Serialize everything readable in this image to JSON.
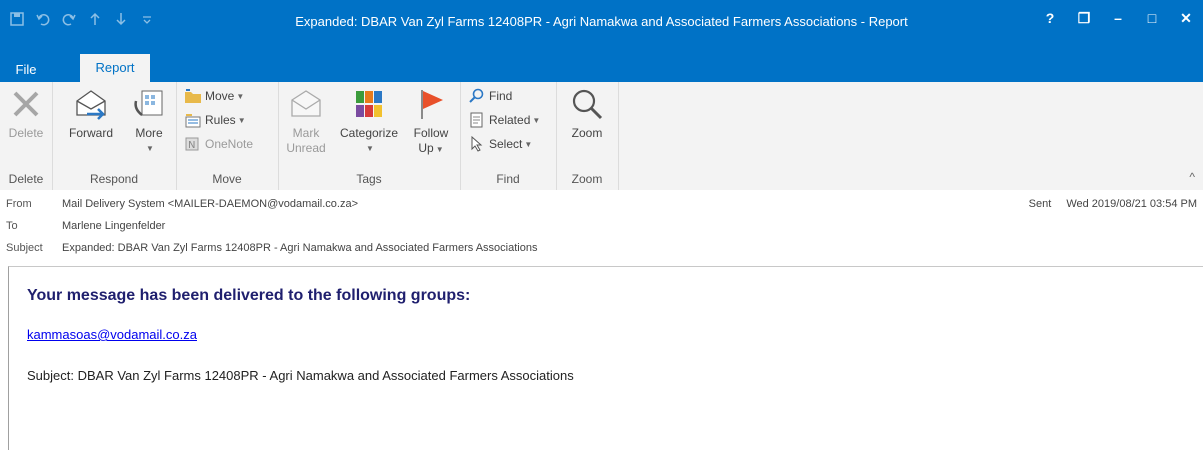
{
  "window": {
    "title": "Expanded: DBAR Van Zyl Farms 12408PR - Agri Namakwa and Associated Farmers Associations - Report",
    "controls": [
      "?",
      "❐",
      "–",
      "□",
      "✕"
    ]
  },
  "tabs": {
    "file": "File",
    "report": "Report"
  },
  "ribbon": {
    "delete": {
      "button": "Delete",
      "group": "Delete"
    },
    "respond": {
      "forward": "Forward",
      "more": "More",
      "group": "Respond"
    },
    "move": {
      "move": "Move",
      "rules": "Rules",
      "onenote": "OneNote",
      "group": "Move"
    },
    "tags": {
      "mark_unread_1": "Mark",
      "mark_unread_2": "Unread",
      "categorize": "Categorize",
      "follow_up_1": "Follow",
      "follow_up_2": "Up",
      "group": "Tags"
    },
    "find": {
      "find": "Find",
      "related": "Related",
      "select": "Select",
      "group": "Find"
    },
    "zoom": {
      "zoom": "Zoom",
      "group": "Zoom"
    }
  },
  "header": {
    "from_label": "From",
    "from": "Mail Delivery System <MAILER-DAEMON@vodamail.co.za>",
    "to_label": "To",
    "to": "Marlene Lingenfelder",
    "subject_label": "Subject",
    "subject": "Expanded: DBAR Van Zyl Farms 12408PR - Agri Namakwa and Associated Farmers Associations",
    "sent_label": "Sent",
    "sent": "Wed 2019/08/21 03:54 PM"
  },
  "body": {
    "heading": "Your message has been delivered to the following groups:",
    "group_link": "kammasoas@vodamail.co.za",
    "subject_line": "Subject: DBAR Van Zyl Farms 12408PR - Agri Namakwa and Associated Farmers Associations"
  },
  "colors": {
    "accent": "#0072c6",
    "ribbon": "#f3f3f3",
    "heading": "#1f1f6e",
    "link": "#0000ee"
  }
}
